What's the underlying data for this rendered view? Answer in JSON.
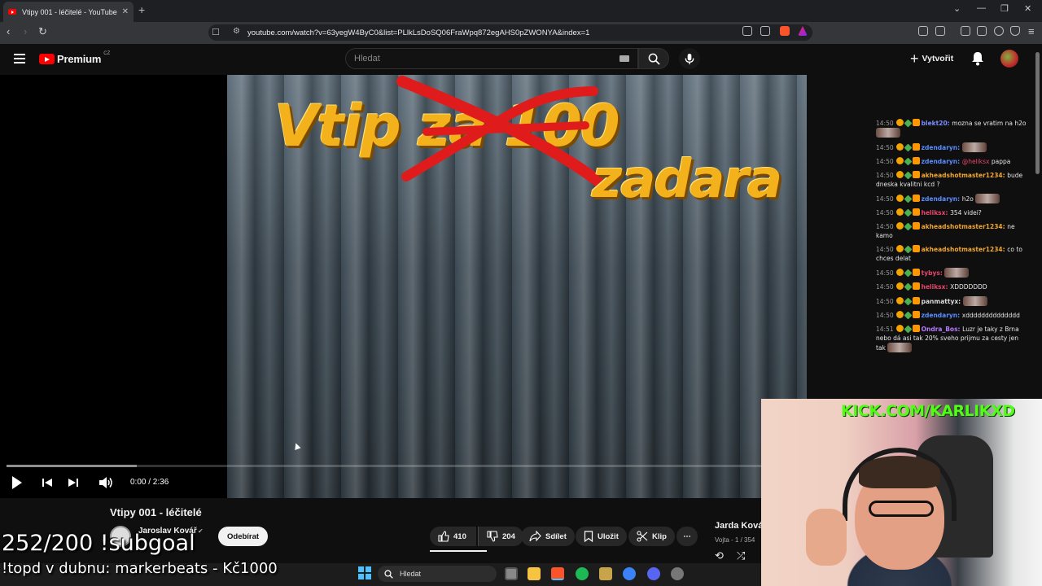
{
  "browser": {
    "tab_title": "Vtipy 001 - léčitelé - YouTube",
    "tab_close": "✕",
    "new_tab": "+",
    "url": "youtube.com/watch?v=63yegW4ByC0&list=PLlkLsDoSQ06FraWpq872egAHS0pZWONYA&index=1"
  },
  "youtube": {
    "logo_text": "Premium",
    "logo_country": "CZ",
    "search_placeholder": "Hledat",
    "create_label": "Vytvořit"
  },
  "video": {
    "overlay_line1": "Vtip za 100",
    "overlay_line2": "zadara",
    "played_fraction": 0.167,
    "time": "0:00 / 2:36",
    "title": "Vtipy 001 - léčitelé",
    "channel": "Jaroslav Kovář",
    "subscribe_label": "Odebírat",
    "likes": "410",
    "dislikes": "204",
    "share_label": "Sdílet",
    "save_label": "Uložit",
    "clip_label": "Klip",
    "more_label": "⋯"
  },
  "playlist": {
    "title": "Jarda Kovář",
    "subtitle": "Vojta - 1 / 354"
  },
  "chat": [
    {
      "time": "14:50",
      "user": "blekt20",
      "color": "#7b8cff",
      "text": "mozna se vratim na h2o",
      "emote": true
    },
    {
      "time": "14:50",
      "user": "zdendaryn",
      "color": "#5a8dff",
      "text": "",
      "emote": true
    },
    {
      "time": "14:50",
      "user": "zdendaryn",
      "color": "#5a8dff",
      "mention": "@heliksx",
      "text": "pappa"
    },
    {
      "time": "14:50",
      "user": "akheadshotmaster1234",
      "color": "#f0a530",
      "text": "bude dneska kvalitni kcd ?"
    },
    {
      "time": "14:50",
      "user": "zdendaryn",
      "color": "#5a8dff",
      "text": "h2o",
      "emote": true
    },
    {
      "time": "14:50",
      "user": "heliksx",
      "color": "#e8456b",
      "text": "354 videi?"
    },
    {
      "time": "14:50",
      "user": "akheadshotmaster1234",
      "color": "#f0a530",
      "text": "ne kamo"
    },
    {
      "time": "14:50",
      "user": "akheadshotmaster1234",
      "color": "#f0a530",
      "text": "co to chces delat"
    },
    {
      "time": "14:50",
      "user": "tybys",
      "color": "#e8456b",
      "text": "",
      "emote": true
    },
    {
      "time": "14:50",
      "user": "heliksx",
      "color": "#e8456b",
      "text": "XDDDDDDD"
    },
    {
      "time": "14:50",
      "user": "panmattyx",
      "color": "#dcdcdc",
      "text": "",
      "emote": true
    },
    {
      "time": "14:50",
      "user": "zdendaryn",
      "color": "#5a8dff",
      "text": "xdddddddddddddd"
    },
    {
      "time": "14:51",
      "user": "Ondra_Bos",
      "color": "#b57bff",
      "text": "Luzr je taky z Brna nebo dá asi tak 20% sveho prijmu za cesty jen tak",
      "emote": true
    }
  ],
  "stream": {
    "kick_url": "KICK.COM/KARLIKXD",
    "subgoal": "252/200 !subgoal",
    "topd": "!topd v dubnu: markerbeats - Kč1000"
  },
  "taskbar": {
    "search_label": "Hledat"
  }
}
